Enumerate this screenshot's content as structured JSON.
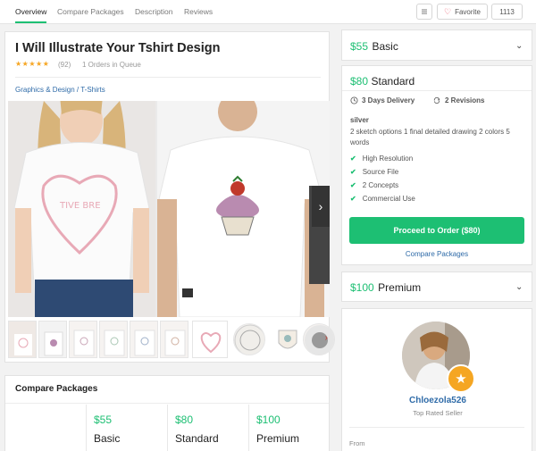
{
  "nav": {
    "tabs": [
      "Overview",
      "Compare Packages",
      "Description",
      "Reviews"
    ],
    "favorite_label": "Favorite",
    "favorite_count": "1113"
  },
  "gig": {
    "title": "I Will Illustrate Your Tshirt Design",
    "stars": "★★★★★",
    "rating_count": "(92)",
    "queue": "1 Orders in Queue",
    "breadcrumb": "Graphics & Design / T-Shirts",
    "gallery_text": "TIVE BRE"
  },
  "compare": {
    "title": "Compare Packages",
    "packages": [
      {
        "price": "$55",
        "name": "Basic"
      },
      {
        "price": "$80",
        "name": "Standard"
      },
      {
        "price": "$100",
        "name": "Premium"
      }
    ]
  },
  "packages": {
    "basic": {
      "price": "$55",
      "name": "Basic"
    },
    "standard": {
      "price": "$80",
      "name": "Standard",
      "delivery": "3 Days Delivery",
      "revisions": "2 Revisions",
      "tier": "silver",
      "description": "2 sketch options 1 final detailed drawing 2 colors 5 words",
      "features": [
        "High Resolution",
        "Source File",
        "2 Concepts",
        "Commercial Use"
      ],
      "order_label": "Proceed to Order ($80)",
      "compare_link": "Compare Packages"
    },
    "premium": {
      "price": "$100",
      "name": "Premium"
    }
  },
  "seller": {
    "name": "Chloezola526",
    "level": "Top Rated Seller",
    "from_label": "From"
  },
  "colors": {
    "accent": "#1dbf73",
    "link": "#2f6ba8",
    "star": "#f6a623",
    "badge": "#f5a623"
  },
  "icons": [
    "list-icon",
    "heart-icon",
    "clock-icon",
    "refresh-icon",
    "check-icon",
    "chevron-down-icon",
    "chevron-right-icon",
    "star-badge-icon"
  ]
}
